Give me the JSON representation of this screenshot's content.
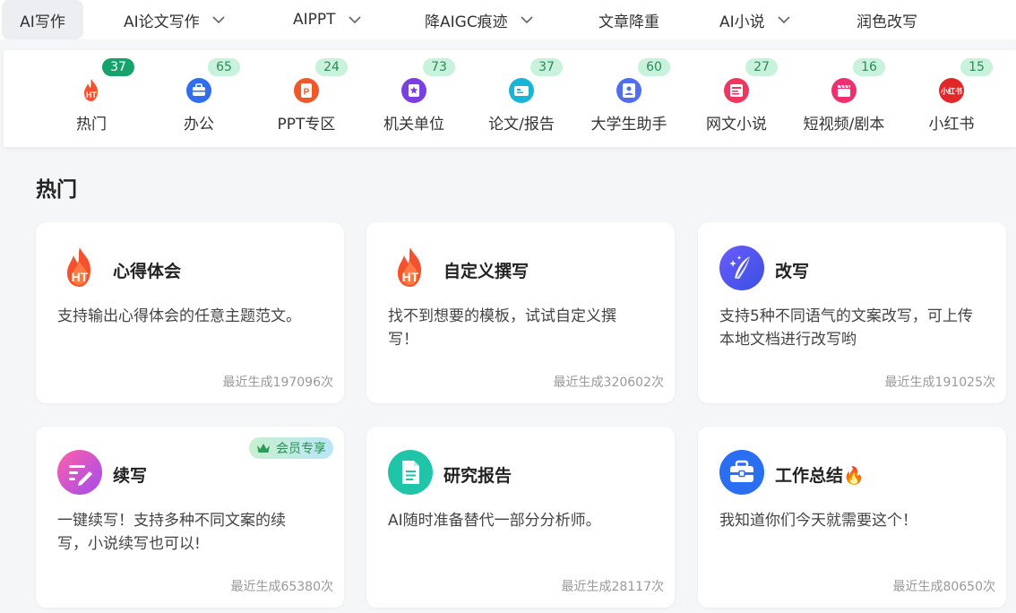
{
  "nav": {
    "items": [
      {
        "label": "AI写作",
        "active": true,
        "dropdown": false
      },
      {
        "label": "AI论文写作",
        "active": false,
        "dropdown": true
      },
      {
        "label": "AIPPT",
        "active": false,
        "dropdown": true
      },
      {
        "label": "降AIGC痕迹",
        "active": false,
        "dropdown": true
      },
      {
        "label": "文章降重",
        "active": false,
        "dropdown": false
      },
      {
        "label": "AI小说",
        "active": false,
        "dropdown": true
      },
      {
        "label": "润色改写",
        "active": false,
        "dropdown": false
      }
    ]
  },
  "categories": [
    {
      "label": "热门",
      "count": "37",
      "icon": "hot-icon",
      "color": "#f4512c"
    },
    {
      "label": "办公",
      "count": "65",
      "icon": "briefcase-icon",
      "color": "#2f6fef"
    },
    {
      "label": "PPT专区",
      "count": "24",
      "icon": "ppt-icon",
      "color": "#f0582a"
    },
    {
      "label": "机关单位",
      "count": "73",
      "icon": "star-badge-icon",
      "color": "#7a3fe0"
    },
    {
      "label": "论文/报告",
      "count": "37",
      "icon": "ticket-icon",
      "color": "#17b6d8"
    },
    {
      "label": "大学生助手",
      "count": "60",
      "icon": "student-icon",
      "color": "#4f6ef0"
    },
    {
      "label": "网文小说",
      "count": "27",
      "icon": "book-icon",
      "color": "#ef3660"
    },
    {
      "label": "短视频/剧本",
      "count": "16",
      "icon": "clapper-icon",
      "color": "#ef2f6f"
    },
    {
      "label": "小红书",
      "count": "15",
      "icon": "xiaohongshu-icon",
      "color": "#e02828"
    }
  ],
  "section": {
    "title": "热门"
  },
  "cards": [
    {
      "title": "心得体会",
      "desc": "支持输出心得体会的任意主题范文。",
      "stat": "最近生成197096次",
      "icon": "hot-flame-icon",
      "vip": ""
    },
    {
      "title": "自定义撰写",
      "desc": "找不到想要的模板，试试自定义撰写！",
      "stat": "最近生成320602次",
      "icon": "hot-flame-icon",
      "vip": ""
    },
    {
      "title": "改写",
      "desc": "支持5种不同语气的文案改写，可上传本地文档进行改写哟",
      "stat": "最近生成191025次",
      "icon": "quill-sparkle-icon",
      "vip": ""
    },
    {
      "title": "续写",
      "desc": "一键续写！支持多种不同文案的续写，小说续写也可以!",
      "stat": "最近生成65380次",
      "icon": "continue-write-icon",
      "vip": "会员专享"
    },
    {
      "title": "研究报告",
      "desc": "AI随时准备替代一部分分析师。",
      "stat": "最近生成28117次",
      "icon": "document-icon",
      "vip": ""
    },
    {
      "title": "工作总结🔥",
      "desc": "我知道你们今天就需要这个！",
      "stat": "最近生成80650次",
      "icon": "toolbox-icon",
      "vip": ""
    }
  ],
  "colors": {
    "badge_hot": "#16a36b",
    "badge": "#c9f2dc",
    "accent_green": "#2a8b59"
  }
}
